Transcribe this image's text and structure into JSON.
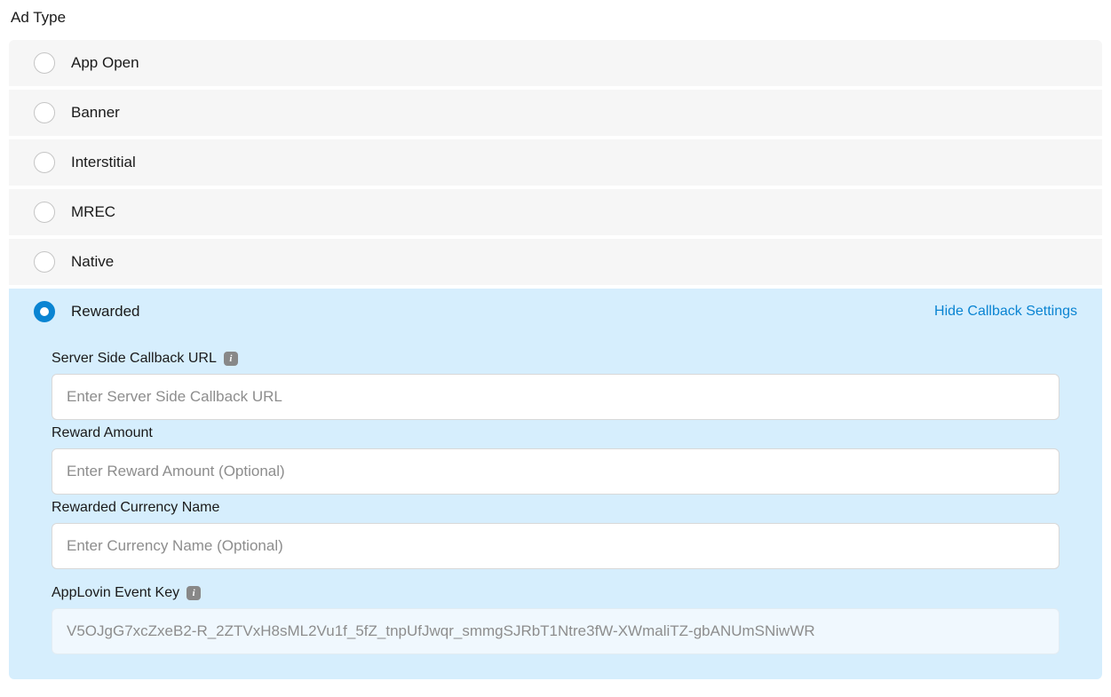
{
  "section_title": "Ad Type",
  "ad_types": [
    {
      "label": "App Open",
      "selected": false
    },
    {
      "label": "Banner",
      "selected": false
    },
    {
      "label": "Interstitial",
      "selected": false
    },
    {
      "label": "MREC",
      "selected": false
    },
    {
      "label": "Native",
      "selected": false
    },
    {
      "label": "Rewarded",
      "selected": true
    }
  ],
  "rewarded": {
    "hide_link": "Hide Callback Settings",
    "callback_url": {
      "label": "Server Side Callback URL",
      "placeholder": "Enter Server Side Callback URL",
      "value": ""
    },
    "reward_amount": {
      "label": "Reward Amount",
      "placeholder": "Enter Reward Amount (Optional)",
      "value": ""
    },
    "currency_name": {
      "label": "Rewarded Currency Name",
      "placeholder": "Enter Currency Name (Optional)",
      "value": ""
    },
    "event_key": {
      "label": "AppLovin Event Key",
      "value": "V5OJgG7xcZxeB2-R_2ZTVxH8sML2Vu1f_5fZ_tnpUfJwqr_smmgSJRbT1Ntre3fW-XWmaliTZ-gbANUmSNiwWR"
    }
  }
}
